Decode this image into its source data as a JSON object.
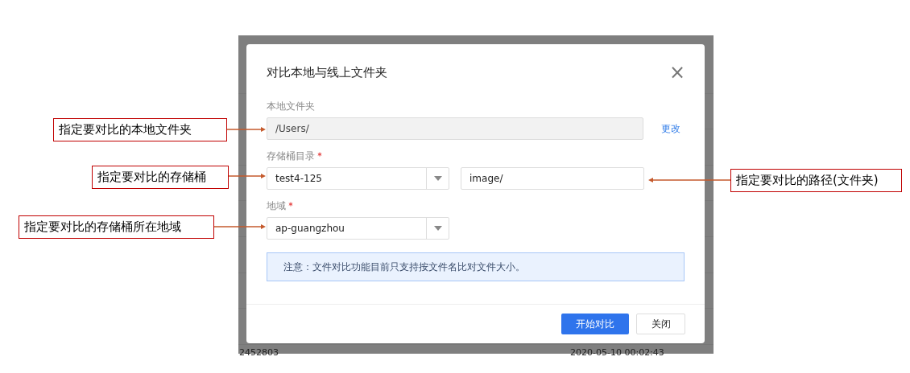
{
  "background_table": {
    "rows": [
      {
        "column_1": "2452803",
        "column_2": "2020-05-10 00:02:43"
      }
    ]
  },
  "dialog": {
    "title": "对比本地与线上文件夹",
    "close": "×",
    "fields": [
      {
        "label": "本地文件夹",
        "controls": [
          {
            "kind": "input",
            "value": "/Users/",
            "disabled": true
          }
        ],
        "link": "更改"
      },
      {
        "label": "存储桶目录",
        "required": true,
        "controls": [
          {
            "kind": "select",
            "value": "test4-125"
          },
          {
            "kind": "input",
            "value": "image/",
            "disabled": false
          }
        ]
      },
      {
        "label": "地域",
        "required": true,
        "controls": [
          {
            "kind": "select",
            "value": "ap-guangzhou"
          }
        ]
      }
    ],
    "notice": "注意：文件对比功能目前只支持按文件名比对文件大小。",
    "buttons": [
      {
        "label": "开始对比",
        "kind": "primary"
      },
      {
        "label": "关闭",
        "kind": "default"
      }
    ]
  },
  "annotations": [
    {
      "text": "指定要对比的本地文件夹"
    },
    {
      "text": "指定要对比的存储桶"
    },
    {
      "text": "指定要对比的路径(文件夹)"
    },
    {
      "text": "指定要对比的存储桶所在地域"
    }
  ]
}
